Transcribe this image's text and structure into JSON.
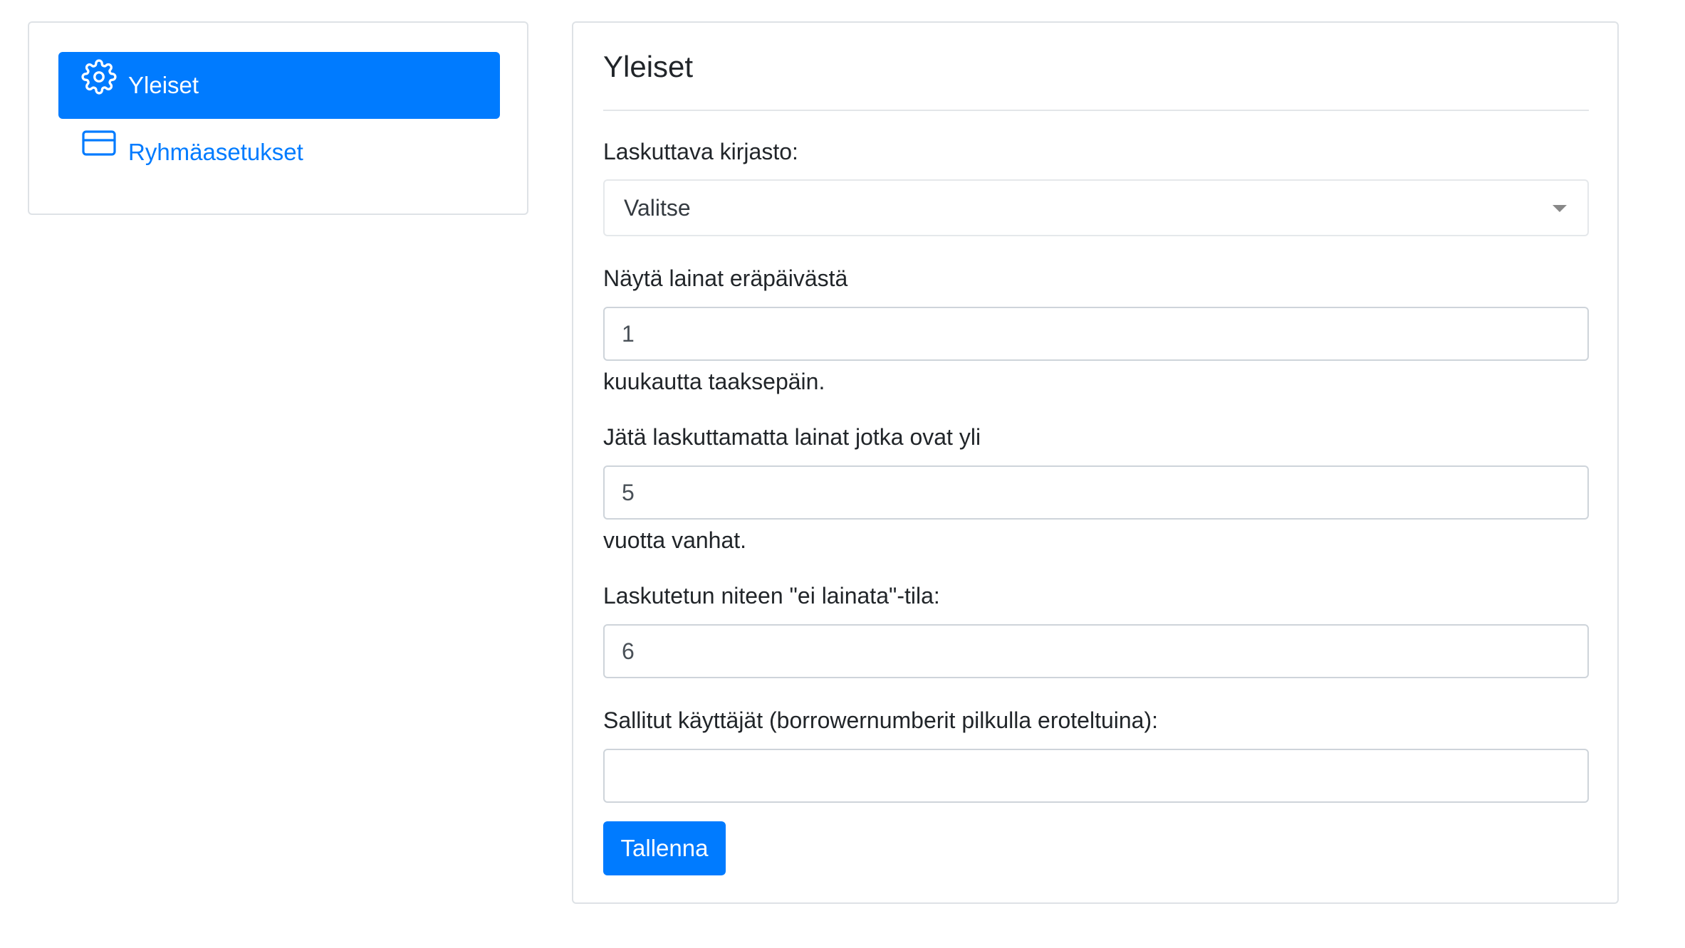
{
  "sidebar": {
    "items": [
      {
        "label": "Yleiset",
        "icon": "gear-icon",
        "active": true
      },
      {
        "label": "Ryhmäasetukset",
        "icon": "credit-card-icon",
        "active": false
      }
    ]
  },
  "main": {
    "title": "Yleiset",
    "billing_library": {
      "label": "Laskuttava kirjasto:",
      "selected": "Valitse"
    },
    "show_loans": {
      "label": "Näytä lainat eräpäivästä",
      "value": "1",
      "suffix": "kuukautta taaksepäin."
    },
    "skip_loans": {
      "label": "Jätä laskuttamatta lainat jotka ovat yli",
      "value": "5",
      "suffix": "vuotta vanhat."
    },
    "not_for_loan": {
      "label": "Laskutetun niteen \"ei lainata\"-tila:",
      "value": "6"
    },
    "allowed_users": {
      "label": "Sallitut käyttäjät (borrowernumberit pilkulla eroteltuina):",
      "value": ""
    },
    "save_label": "Tallenna"
  },
  "colors": {
    "primary": "#007bff",
    "border": "#ced4da",
    "text": "#212529"
  }
}
